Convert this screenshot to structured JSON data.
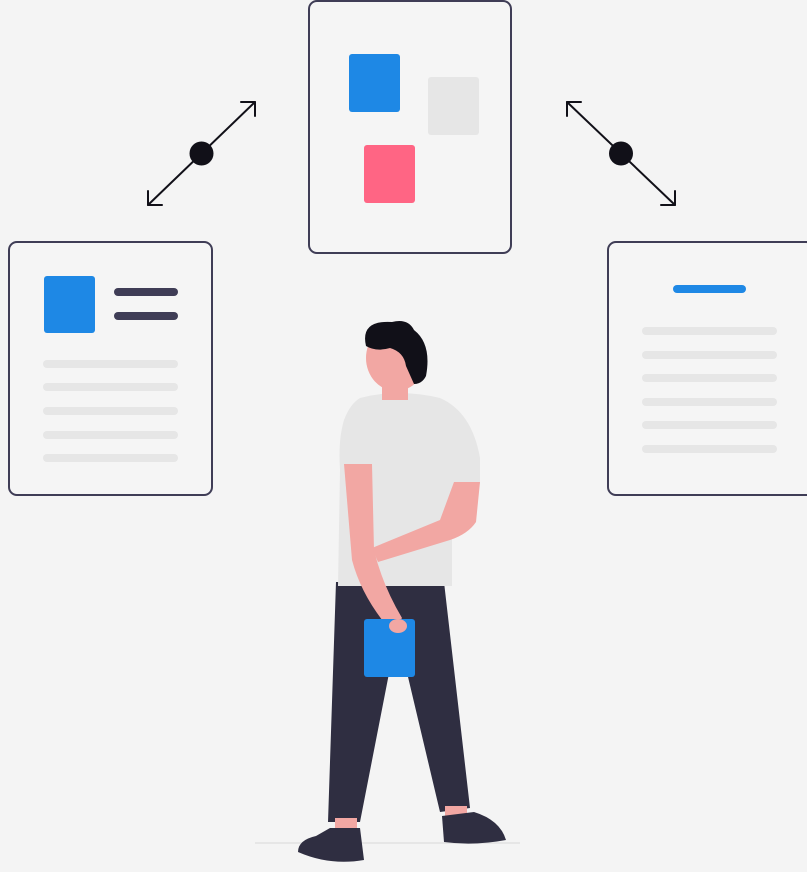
{
  "illustration": {
    "subject": "person-viewing-connected-document-cards",
    "colors": {
      "background": "#f4f4f4",
      "card_fill": "#f5f5f5",
      "card_border": "#3f3d56",
      "accent_blue": "#1e88e5",
      "accent_pink": "#ff6584",
      "light_gray": "#e6e6e6",
      "dark_navy": "#2f2e41",
      "skin": "#f2a7a3",
      "hair": "#111018",
      "shirt": "#e6e6e6"
    },
    "icons": [
      "double-arrow-connector-left-icon",
      "double-arrow-connector-right-icon"
    ]
  }
}
